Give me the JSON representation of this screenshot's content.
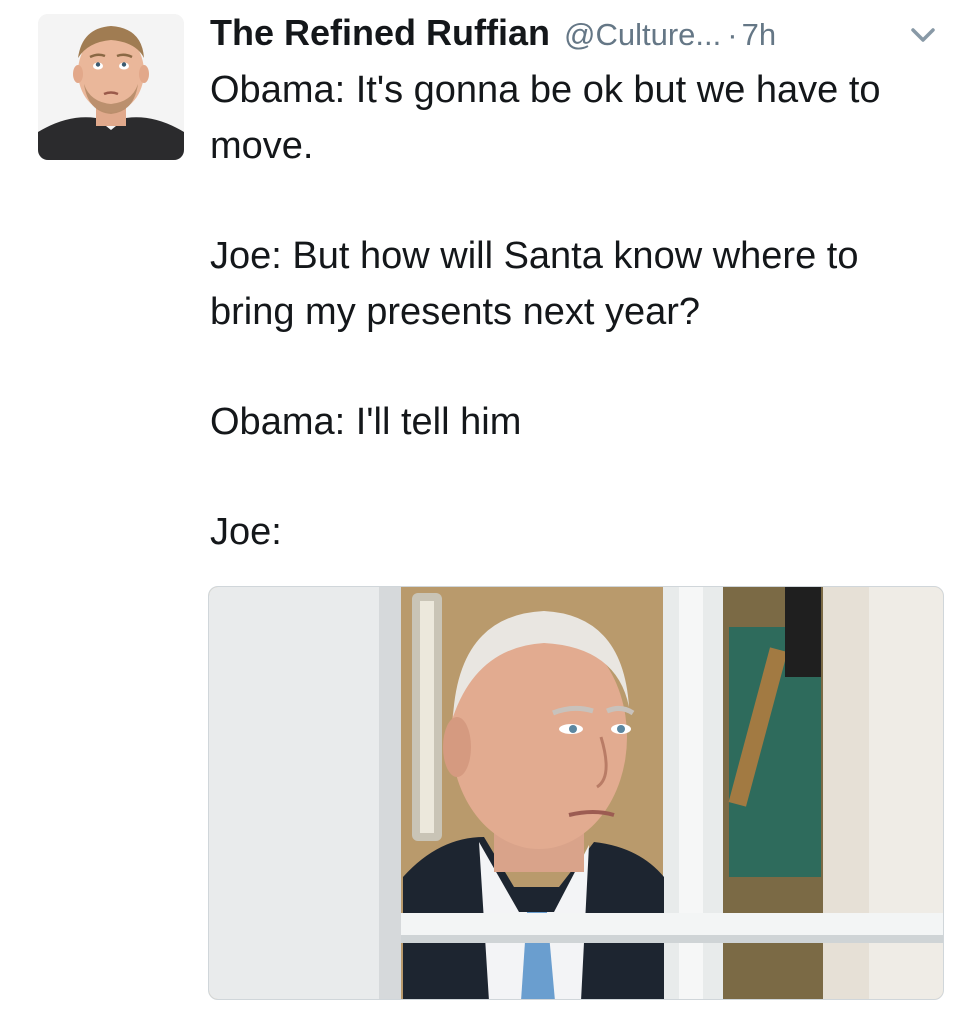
{
  "tweet": {
    "author": {
      "display_name": "The Refined Ruffian",
      "handle": "@Culture...",
      "avatar_icon": "profile-photo"
    },
    "separator": "·",
    "time": "7h",
    "menu_icon": "chevron-down-icon",
    "lines": [
      "Obama: It's gonna be ok but we have to move.",
      "Joe: But how will Santa know where to bring my presents next year?",
      "Obama: I'll tell him",
      "Joe:"
    ],
    "media": {
      "type": "photo",
      "icon": "photo-of-man-looking-through-window"
    }
  },
  "colors": {
    "text": "#14171a",
    "secondary": "#657786",
    "background": "#ffffff",
    "border": "#d0d6da"
  }
}
